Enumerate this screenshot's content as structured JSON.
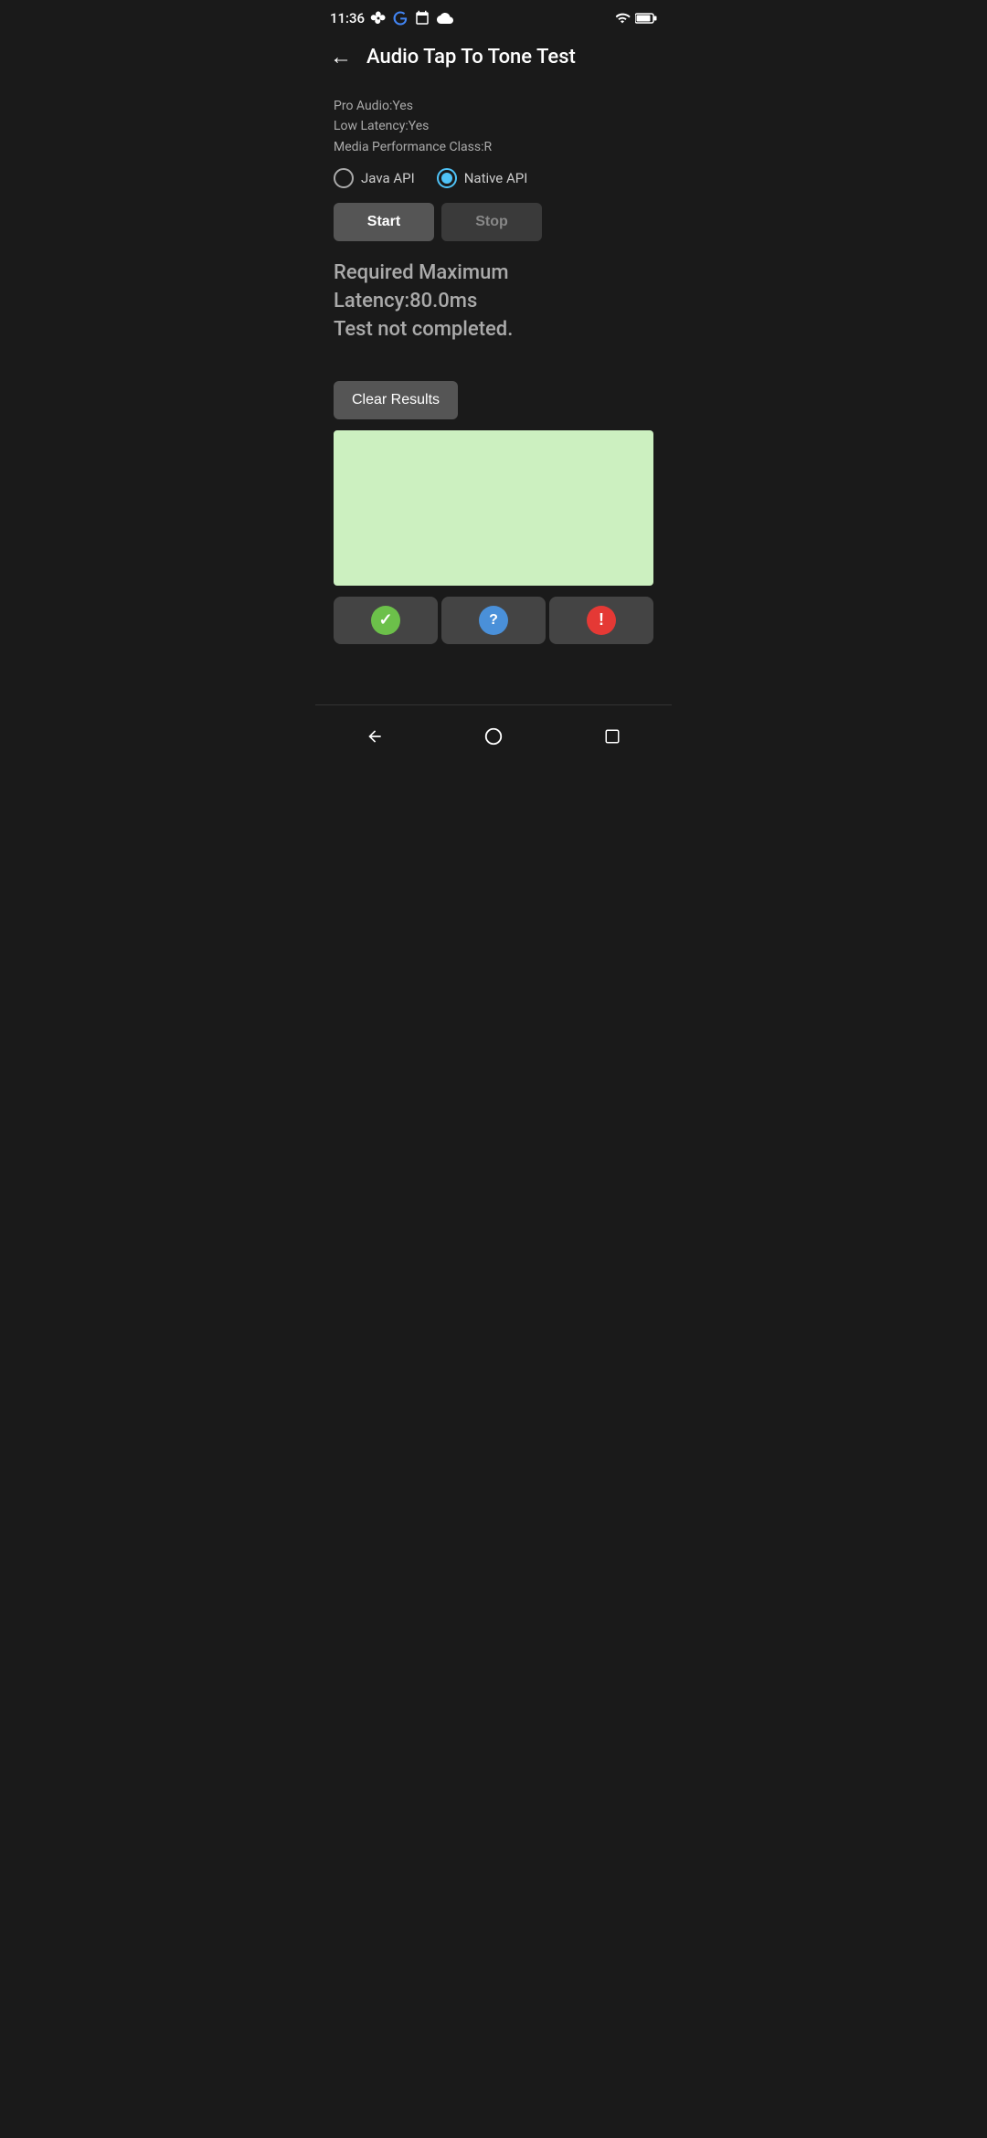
{
  "statusBar": {
    "time": "11:36",
    "icons": [
      "fan-icon",
      "google-icon",
      "calendar-icon",
      "cloud-icon",
      "wifi-icon",
      "battery-icon"
    ]
  },
  "appBar": {
    "title": "Audio Tap To Tone Test",
    "backLabel": "←"
  },
  "infoLines": {
    "proAudio": "Pro Audio:Yes",
    "lowLatency": "Low Latency:Yes",
    "mediaPerf": "Media Performance Class:R"
  },
  "radioGroup": {
    "options": [
      {
        "id": "java",
        "label": "Java API",
        "selected": false
      },
      {
        "id": "native",
        "label": "Native API",
        "selected": true
      }
    ]
  },
  "buttons": {
    "start": "Start",
    "stop": "Stop"
  },
  "statusText": {
    "line1": "Required Maximum Latency:80.0ms",
    "line2": "Test not completed."
  },
  "clearResults": "Clear Results",
  "bottomActions": {
    "check": "✓",
    "question": "?",
    "exclamation": "!"
  },
  "navBar": {
    "back": "◀",
    "home": "○",
    "recent": "□"
  }
}
